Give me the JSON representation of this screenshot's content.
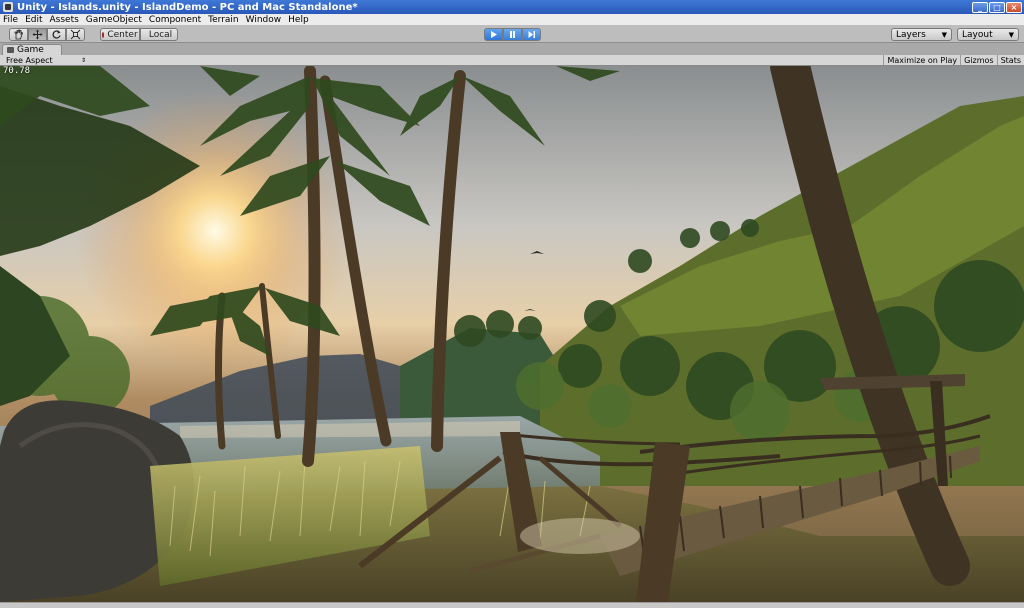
{
  "window": {
    "title": "Unity - Islands.unity - IslandDemo - PC and Mac Standalone*"
  },
  "menu": [
    "File",
    "Edit",
    "Assets",
    "GameObject",
    "Component",
    "Terrain",
    "Window",
    "Help"
  ],
  "toolbar": {
    "transform_tools": [
      "hand-tool",
      "move-tool",
      "rotate-tool",
      "scale-tool"
    ],
    "pivot_center": "Center",
    "pivot_local": "Local",
    "play_controls": [
      "play",
      "pause",
      "step"
    ],
    "play_state": "playing",
    "layers": "Layers",
    "layout": "Layout"
  },
  "tab": {
    "label": "Game"
  },
  "game_view": {
    "aspect": "Free Aspect",
    "maximize_on_play": "Maximize on Play",
    "gizmos": "Gizmos",
    "stats": "Stats",
    "fps": "70.78"
  },
  "colors": {
    "title_bar": "#2f62c4",
    "play_active": "#3a80e0",
    "toolbar": "#bdbdbd"
  }
}
